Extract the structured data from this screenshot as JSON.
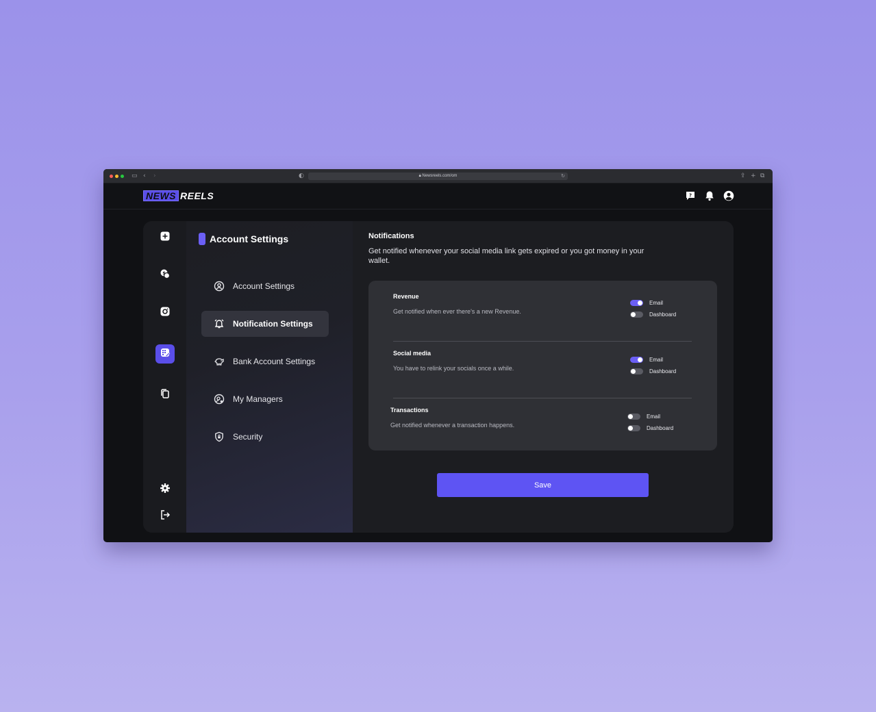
{
  "browser": {
    "url": "Newsreels.com/om",
    "traffic_colors": [
      "#ff5f57",
      "#febc2e",
      "#28c840"
    ]
  },
  "brand": {
    "part1": "NEWS",
    "part2": "REELS",
    "accent": "#5a4ee8"
  },
  "header": {
    "icons": [
      "help-chat-icon",
      "bell-icon",
      "user-avatar-icon"
    ]
  },
  "rail": {
    "items": [
      "dashboard-icon",
      "coins-icon",
      "instagram-icon",
      "grid-edit-icon",
      "copy-icon"
    ],
    "active_index": 3,
    "bottom": [
      "gear-icon",
      "logout-icon"
    ]
  },
  "settings_nav": {
    "title": "Account Settings",
    "items": [
      {
        "label": "Account Settings",
        "icon": "user-circle-icon"
      },
      {
        "label": "Notification Settings",
        "icon": "alarm-bell-icon",
        "active": true
      },
      {
        "label": "Bank Account Settings",
        "icon": "piggy-bank-icon"
      },
      {
        "label": "My Managers",
        "icon": "managers-icon"
      },
      {
        "label": "Security",
        "icon": "shield-lock-icon"
      }
    ]
  },
  "notifications": {
    "title": "Notifications",
    "description": "Get notified whenever your social media link gets expired or you got money in your wallet.",
    "groups": [
      {
        "title": "Revenue",
        "description": "Get notified when ever there's a new Revenue.",
        "options": [
          {
            "label": "Email",
            "on": true
          },
          {
            "label": "Dashboard",
            "on": false
          }
        ]
      },
      {
        "title": "Social media",
        "description": "You have to relink your socials once a while.",
        "options": [
          {
            "label": "Email",
            "on": true
          },
          {
            "label": "Dashboard",
            "on": false
          }
        ]
      },
      {
        "title": "Transactions",
        "description": "Get notified whenever a transaction happens.",
        "options": [
          {
            "label": "Email",
            "on": false
          },
          {
            "label": "Dashboard",
            "on": false
          }
        ]
      }
    ],
    "save_label": "Save",
    "accent_color": "#6b5ff5"
  }
}
